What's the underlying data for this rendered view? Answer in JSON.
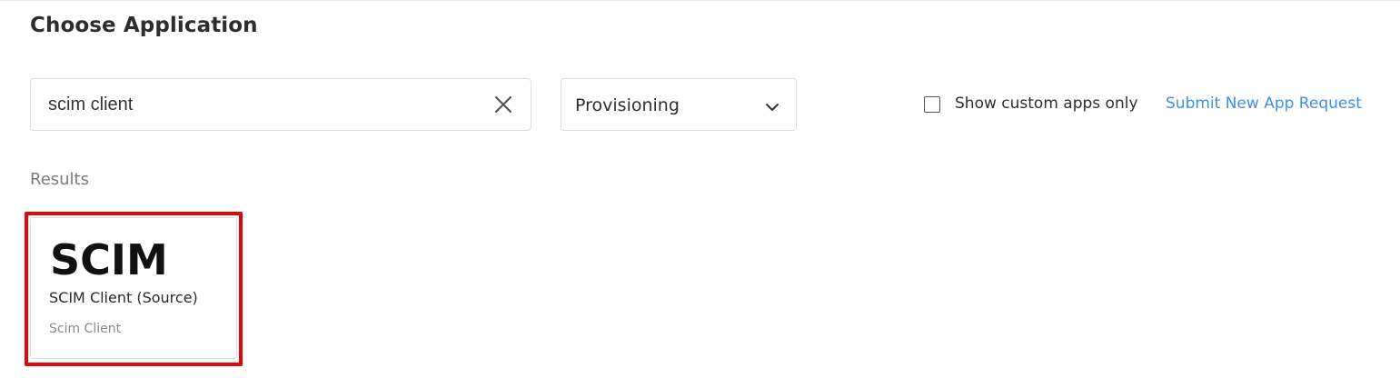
{
  "page": {
    "title": "Choose Application"
  },
  "search": {
    "value": "scim client"
  },
  "filter": {
    "selected": "Provisioning"
  },
  "custom_apps": {
    "label": "Show custom apps only",
    "checked": false
  },
  "submit_link": {
    "label": "Submit New App Request"
  },
  "results": {
    "heading": "Results",
    "items": [
      {
        "logo_text": "SCIM",
        "name": "SCIM Client (Source)",
        "subtitle": "Scim Client",
        "highlighted": true
      }
    ]
  },
  "colors": {
    "link": "#3d8fe6",
    "highlight": "#e3070b"
  },
  "icons": {
    "clear": "close-icon",
    "dropdown": "chevron-down-icon",
    "checkbox": "checkbox-icon"
  }
}
